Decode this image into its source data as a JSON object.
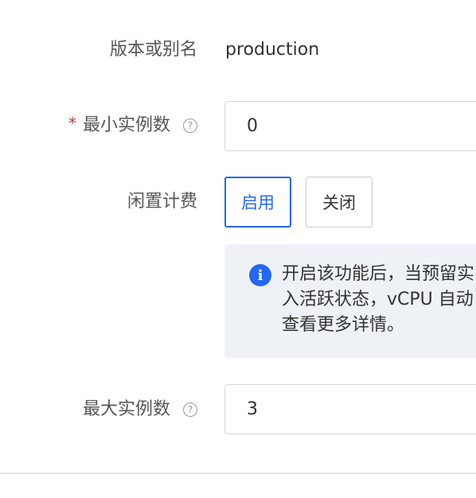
{
  "fields": {
    "version_alias": {
      "label": "版本或别名",
      "value": "production"
    },
    "min_instances": {
      "required_mark": "*",
      "label": "最小实例数",
      "value": "0"
    },
    "idle_billing": {
      "label": "闲置计费",
      "enable_label": "启用",
      "disable_label": "关闭",
      "selected": "启用"
    },
    "notice": {
      "line1": "开启该功能后，当预留实",
      "line2": "入活跃状态，vCPU 自动",
      "line3": "查看更多详情。"
    },
    "max_instances": {
      "label": "最大实例数",
      "value": "3"
    }
  },
  "icons": {
    "help": "question-circle-icon",
    "info": "info-circle-icon"
  },
  "colors": {
    "accent": "#2468f2",
    "required": "#d9363e",
    "notice_bg": "#eef2f7"
  }
}
